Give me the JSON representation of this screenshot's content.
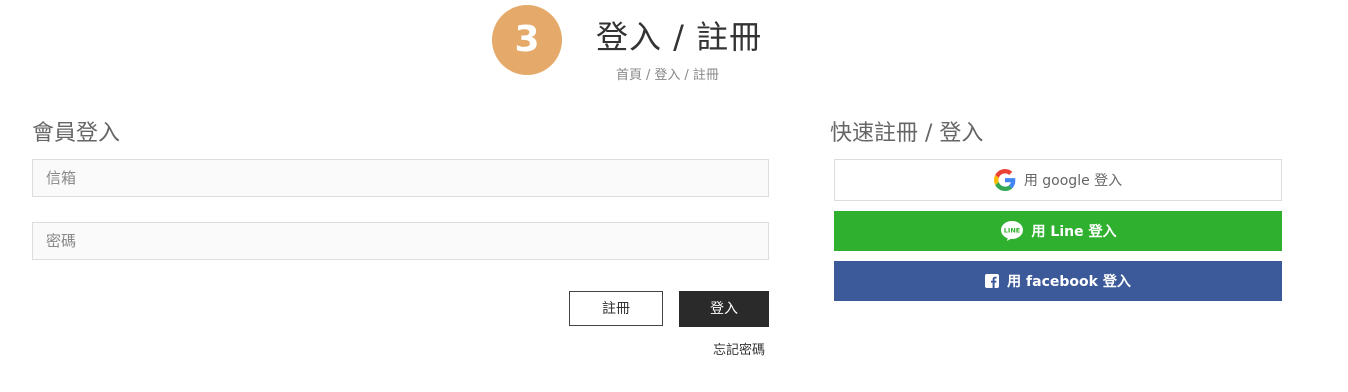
{
  "header": {
    "step_number": "3",
    "title": "登入 / 註冊",
    "breadcrumb": {
      "home": "首頁",
      "login": "登入",
      "register": "註冊",
      "separator": "/"
    }
  },
  "login": {
    "title": "會員登入",
    "email_placeholder": "信箱",
    "password_placeholder": "密碼",
    "register_label": "註冊",
    "login_label": "登入",
    "forgot_label": "忘記密碼"
  },
  "quick": {
    "title": "快速註冊 / 登入",
    "google_label": "用 google 登入",
    "line_label": "用 Line 登入",
    "line_icon_text": "LINE",
    "facebook_label": "用 facebook 登入"
  },
  "colors": {
    "step_circle": "#e5aa69",
    "line_green": "#2fb12f",
    "facebook_blue": "#3c5a9a",
    "login_button": "#2a2a2a"
  },
  "icons": {
    "google": "google-g-icon",
    "line": "line-logo-icon",
    "facebook": "facebook-f-icon"
  }
}
